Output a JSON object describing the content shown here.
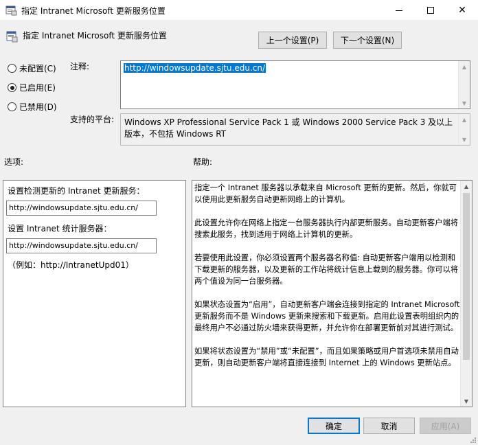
{
  "window": {
    "title": "指定 Intranet Microsoft 更新服务位置",
    "minimize_glyph": "—",
    "close_glyph": "✕"
  },
  "header": {
    "policy_title": "指定 Intranet Microsoft 更新服务位置",
    "prev_setting": "上一个设置(P)",
    "next_setting": "下一个设置(N)"
  },
  "state": {
    "options": [
      {
        "label": "未配置(C)",
        "checked": false
      },
      {
        "label": "已启用(E)",
        "checked": true
      },
      {
        "label": "已禁用(D)",
        "checked": false
      }
    ]
  },
  "comment": {
    "label": "注释:",
    "value": "http://windowsupdate.sjtu.edu.cn/"
  },
  "platform": {
    "label": "支持的平台:",
    "value": "Windows XP Professional Service Pack 1 或 Windows 2000 Service Pack 3 及以上版本，不包括 Windows RT"
  },
  "options_panel": {
    "heading": "选项:",
    "update_service_label": "设置检测更新的 Intranet 更新服务：",
    "update_service_value": "http://windowsupdate.sjtu.edu.cn/",
    "stats_server_label": "设置 Intranet 统计服务器：",
    "stats_server_value": "http://windowsupdate.sjtu.edu.cn/",
    "example": "（例如：http://IntranetUpd01）"
  },
  "help_panel": {
    "heading": "帮助:",
    "paragraphs": [
      "指定一个 Intranet 服务器以承载来自 Microsoft 更新的更新。然后，你就可以使用此更新服务自动更新网络上的计算机。",
      "此设置允许你在网络上指定一台服务器执行内部更新服务。自动更新客户端将搜索此服务，找到适用于网络上计算机的更新。",
      "若要使用此设置，你必须设置两个服务器名称值: 自动更新客户端用以检测和下载更新的服务器，以及更新的工作站将统计信息上载到的服务器。你可以将两个值设为同一台服务器。",
      "如果状态设置为“启用”，自动更新客户端会连接到指定的 Intranet Microsoft 更新服务而不是 Windows 更新来搜索和下载更新。启用此设置表明组织内的最终用户不必通过防火墙来获得更新，并允许你在部署更新前对其进行测试。",
      "如果将状态设置为“禁用”或“未配置”，而且如果策略或用户首选项未禁用自动更新，则自动更新客户端将直接连接到 Internet 上的 Windows 更新站点。"
    ]
  },
  "footer": {
    "ok": "确定",
    "cancel": "取消",
    "apply": "应用(A)"
  },
  "colors": {
    "accent": "#0078d7",
    "background": "#f0f0f0"
  }
}
